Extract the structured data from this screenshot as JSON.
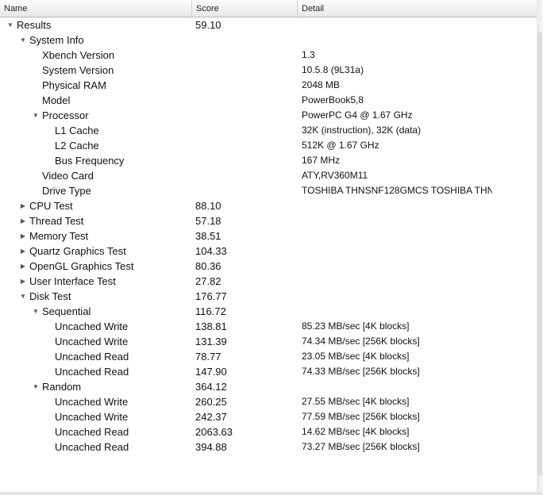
{
  "header": {
    "name": "Name",
    "score": "Score",
    "detail": "Detail"
  },
  "rows": [
    {
      "name": "Results",
      "score": "59.10",
      "detail": "",
      "level": 0,
      "toggle": "expanded"
    },
    {
      "name": "System Info",
      "score": "",
      "detail": "",
      "level": 1,
      "toggle": "expanded"
    },
    {
      "name": "Xbench Version",
      "score": "",
      "detail": "1.3",
      "level": 2,
      "toggle": "none"
    },
    {
      "name": "System Version",
      "score": "",
      "detail": "10.5.8 (9L31a)",
      "level": 2,
      "toggle": "none"
    },
    {
      "name": "Physical RAM",
      "score": "",
      "detail": "2048 MB",
      "level": 2,
      "toggle": "none"
    },
    {
      "name": "Model",
      "score": "",
      "detail": "PowerBook5,8",
      "level": 2,
      "toggle": "none"
    },
    {
      "name": "Processor",
      "score": "",
      "detail": "PowerPC G4 @ 1.67 GHz",
      "level": 2,
      "toggle": "expanded"
    },
    {
      "name": "L1 Cache",
      "score": "",
      "detail": "32K (instruction), 32K (data)",
      "level": 3,
      "toggle": "none"
    },
    {
      "name": "L2 Cache",
      "score": "",
      "detail": "512K @ 1.67 GHz",
      "level": 3,
      "toggle": "none"
    },
    {
      "name": "Bus Frequency",
      "score": "",
      "detail": "167 MHz",
      "level": 3,
      "toggle": "none"
    },
    {
      "name": "Video Card",
      "score": "",
      "detail": "ATY,RV360M11",
      "level": 2,
      "toggle": "none"
    },
    {
      "name": "Drive Type",
      "score": "",
      "detail": "TOSHIBA THNSNF128GMCS TOSHIBA THN",
      "level": 2,
      "toggle": "none"
    },
    {
      "name": "CPU Test",
      "score": "88.10",
      "detail": "",
      "level": 1,
      "toggle": "collapsed"
    },
    {
      "name": "Thread Test",
      "score": "57.18",
      "detail": "",
      "level": 1,
      "toggle": "collapsed"
    },
    {
      "name": "Memory Test",
      "score": "38.51",
      "detail": "",
      "level": 1,
      "toggle": "collapsed"
    },
    {
      "name": "Quartz Graphics Test",
      "score": "104.33",
      "detail": "",
      "level": 1,
      "toggle": "collapsed"
    },
    {
      "name": "OpenGL Graphics Test",
      "score": "80.36",
      "detail": "",
      "level": 1,
      "toggle": "collapsed"
    },
    {
      "name": "User Interface Test",
      "score": "27.82",
      "detail": "",
      "level": 1,
      "toggle": "collapsed"
    },
    {
      "name": "Disk Test",
      "score": "176.77",
      "detail": "",
      "level": 1,
      "toggle": "expanded"
    },
    {
      "name": "Sequential",
      "score": "116.72",
      "detail": "",
      "level": 2,
      "toggle": "expanded"
    },
    {
      "name": "Uncached Write",
      "score": "138.81",
      "detail": "85.23 MB/sec [4K blocks]",
      "level": 3,
      "toggle": "none"
    },
    {
      "name": "Uncached Write",
      "score": "131.39",
      "detail": "74.34 MB/sec [256K blocks]",
      "level": 3,
      "toggle": "none"
    },
    {
      "name": "Uncached Read",
      "score": "78.77",
      "detail": "23.05 MB/sec [4K blocks]",
      "level": 3,
      "toggle": "none"
    },
    {
      "name": "Uncached Read",
      "score": "147.90",
      "detail": "74.33 MB/sec [256K blocks]",
      "level": 3,
      "toggle": "none"
    },
    {
      "name": "Random",
      "score": "364.12",
      "detail": "",
      "level": 2,
      "toggle": "expanded"
    },
    {
      "name": "Uncached Write",
      "score": "260.25",
      "detail": "27.55 MB/sec [4K blocks]",
      "level": 3,
      "toggle": "none"
    },
    {
      "name": "Uncached Write",
      "score": "242.37",
      "detail": "77.59 MB/sec [256K blocks]",
      "level": 3,
      "toggle": "none"
    },
    {
      "name": "Uncached Read",
      "score": "2063.63",
      "detail": "14.62 MB/sec [4K blocks]",
      "level": 3,
      "toggle": "none"
    },
    {
      "name": "Uncached Read",
      "score": "394.88",
      "detail": "73.27 MB/sec [256K blocks]",
      "level": 3,
      "toggle": "none"
    }
  ]
}
